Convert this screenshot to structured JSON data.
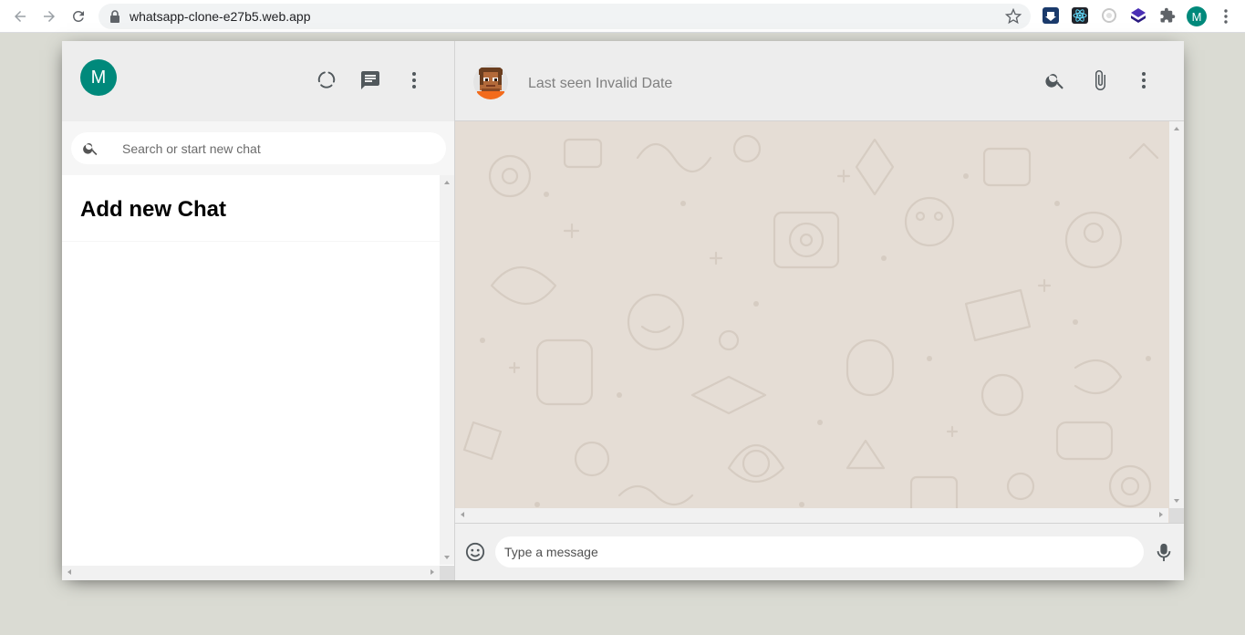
{
  "browser": {
    "url": "whatsapp-clone-e27b5.web.app",
    "profile_initial": "M",
    "extension_icons": [
      "download-icon",
      "react-devtools-icon",
      "circle-extension-icon",
      "cube-extension-icon",
      "puzzle-icon"
    ]
  },
  "sidebar": {
    "user_initial": "M",
    "header_icons": [
      "status-icon",
      "chat-icon",
      "more-vert-icon"
    ],
    "search": {
      "placeholder": "Search or start new chat",
      "value": ""
    },
    "add_new_chat_label": "Add new Chat"
  },
  "chat": {
    "last_seen_text": "Last seen Invalid Date",
    "header_icons": [
      "search-icon",
      "attach-icon",
      "more-vert-icon"
    ],
    "message_input": {
      "placeholder": "Type a message",
      "value": ""
    },
    "footer_icons": [
      "emoji-icon",
      "mic-icon"
    ]
  },
  "colors": {
    "accent": "#00897b",
    "panel_header": "#ededed",
    "chat_background": "#e5ddd5",
    "page_background": "#dadbd3"
  }
}
